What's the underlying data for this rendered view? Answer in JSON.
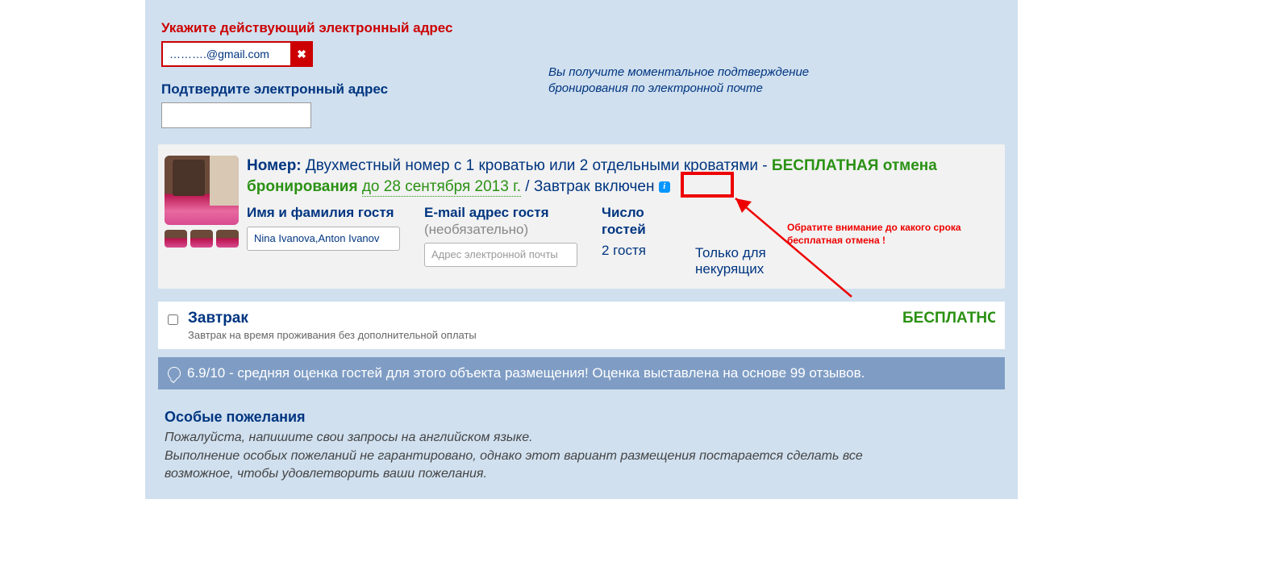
{
  "email": {
    "label_red": "Укажите действующий электронный адрес",
    "value": "……….@gmail.com",
    "clear": "✖",
    "confirm_label": "Подтвердите электронный адрес",
    "side_note": "Вы получите моментальное подтверждение бронирования по электронной почте"
  },
  "room": {
    "row_label": "Номер:",
    "name_part1": " Двухместный номер с 1 кроватью или 2 отдельными кроватями - ",
    "free_text": "БЕСПЛАТНАЯ отмена бронирования",
    "date_text": "до 28 сентября 2013 г.",
    "sep_breakfast": " / Завтрак включен ",
    "guest": {
      "name_hdr": "Имя и фамилия гостя",
      "name_val": "Nina Ivanova,Anton Ivanov",
      "email_hdr": "E-mail адрес гостя",
      "email_sub": "(необязательно)",
      "email_ph": "Адрес электронной почты",
      "count_hdr": "Число гостей",
      "count_val": "2 гостя",
      "nosmoke": "Только для некурящих"
    }
  },
  "annot": "Обратите внимание до какого срока бесплатная отмена !",
  "breakfast": {
    "title": "Завтрак",
    "desc": "Завтрак на время проживания без дополнительной оплаты",
    "free": "БЕСПЛАТНО"
  },
  "rating_text": "6.9/10 - средняя оценка гостей для этого объекта размещения! Оценка выставлена на основе 99 отзывов.",
  "wishes": {
    "hdr": "Особые пожелания",
    "txt": "Пожалуйста, напишите свои запросы на английском языке.\nВыполнение особых пожеланий не гарантировано, однако этот вариант размещения постарается сделать все возможное, чтобы удовлетворить ваши пожелания."
  }
}
